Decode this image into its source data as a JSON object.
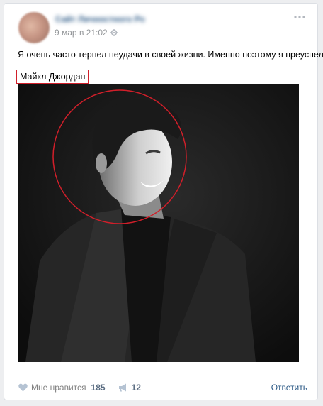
{
  "post": {
    "author": "Сайт Личностного Роста",
    "date": "9 мар в 21:02",
    "text": "Я очень часто терпел неудачи в своей жизни. Именно поэтому я преуспел.",
    "highlight_name": "Майкл Джордан"
  },
  "footer": {
    "like_label": "Мне нравится",
    "like_count": "185",
    "share_count": "12",
    "reply_label": "Ответить"
  },
  "icons": {
    "settings": "gear-icon",
    "more": "more-icon",
    "like": "heart-icon",
    "share": "megaphone-icon"
  },
  "colors": {
    "link": "#2a5885",
    "highlight_border": "#d11f2a",
    "counter": "#5b6d82"
  }
}
